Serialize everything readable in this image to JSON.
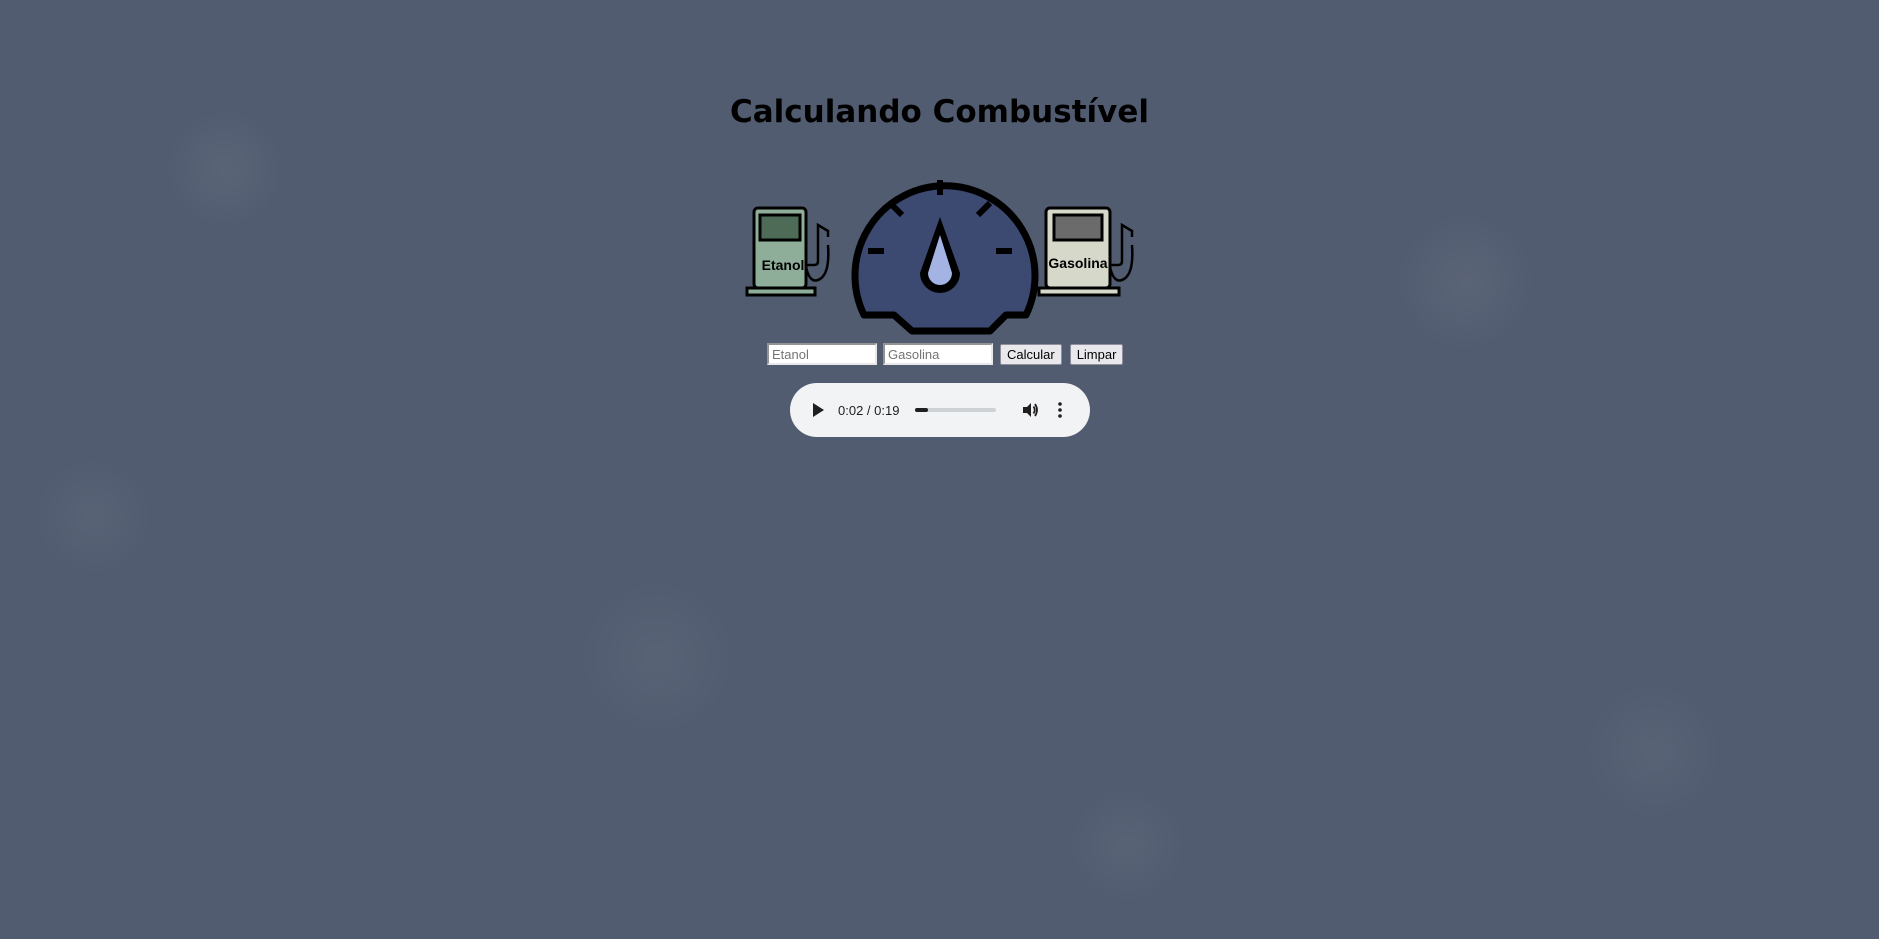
{
  "page": {
    "title": "Calculando Combustível"
  },
  "illustration": {
    "pump_left_label": "Etanol",
    "pump_right_label": "Gasolina",
    "pump_left_color": "#8fae99",
    "pump_right_color": "#d6d8c9",
    "gauge_color": "#3c4a72",
    "drop_color": "#a3b3e3",
    "gauge_icon": "fuel-gauge-icon"
  },
  "form": {
    "etanol_placeholder": "Etanol",
    "etanol_value": "",
    "gasolina_placeholder": "Gasolina",
    "gasolina_value": "",
    "calcular_label": "Calcular",
    "limpar_label": "Limpar"
  },
  "audio": {
    "time_display": "0:02 / 0:19",
    "progress_fraction": 0.15,
    "play_icon": "play-icon",
    "volume_icon": "volume-icon",
    "more_icon": "more-options-icon"
  }
}
